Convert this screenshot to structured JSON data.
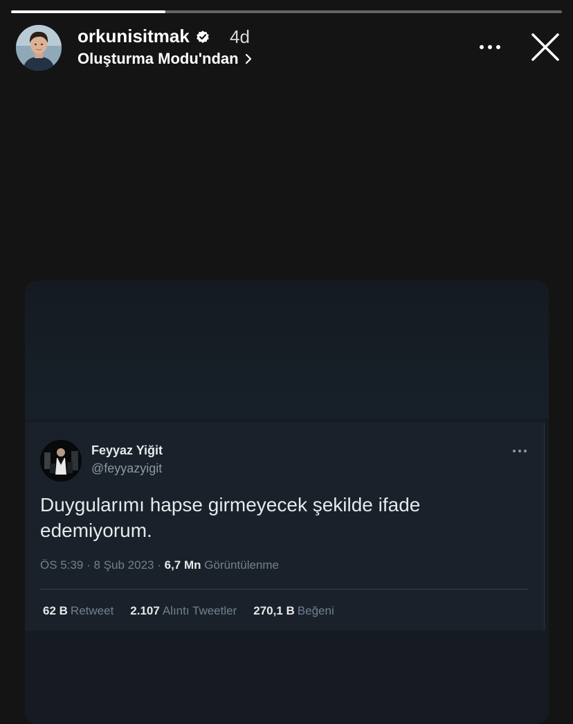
{
  "story": {
    "progress": 0.28,
    "username": "orkunisitmak",
    "age": "4d",
    "subtitle": "Oluşturma Modu'ndan",
    "icons": {
      "verified": "verified-badge-icon",
      "more": "more-options-icon",
      "close": "close-icon",
      "subtitle": "chevron-right-icon"
    }
  },
  "tweet": {
    "name": "Feyyaz Yiğit",
    "handle": "@feyyazyigit",
    "text": "Duygularımı hapse girmeyecek şekilde ifade edemiyorum.",
    "meta": {
      "time": "ÖS 5:39",
      "sep1": "·",
      "date": "8 Şub 2023",
      "sep2": "·",
      "views_count": "6,7 Mn",
      "views_label": "Görüntülenme"
    },
    "stats": {
      "retweets_count": "62 B",
      "retweets_label": "Retweet",
      "quotes_count": "2.107",
      "quotes_label": "Alıntı Tweetler",
      "likes_count": "270,1 B",
      "likes_label": "Beğeni"
    }
  },
  "colors": {
    "background": "#141414",
    "tweet_background": "#1a212b",
    "tweet_text": "#e7e9ea",
    "tweet_secondary": "#8b98a5"
  }
}
